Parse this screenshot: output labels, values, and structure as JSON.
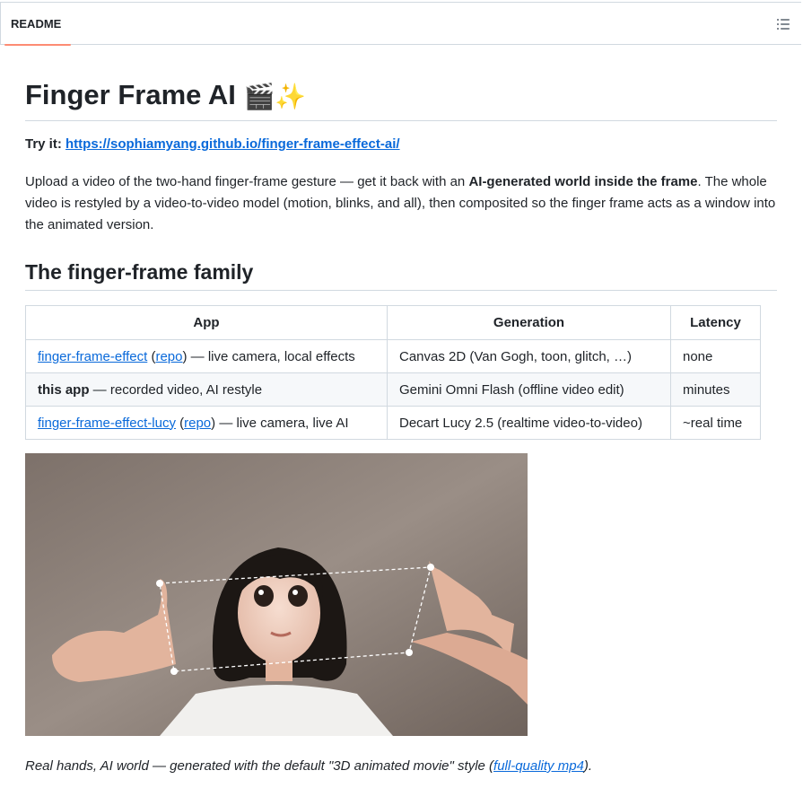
{
  "tabs": {
    "readme_label": "README",
    "toc_icon": "list-unordered-icon"
  },
  "readme": {
    "title": "Finger Frame AI",
    "title_emoji_1": "🎬",
    "title_emoji_2": "✨",
    "try_label": "Try it:",
    "try_url": "https://sophiamyang.github.io/finger-frame-effect-ai/",
    "intro_part1": "Upload a video of the two-hand finger-frame gesture — get it back with an ",
    "intro_bold": "AI-generated world inside the frame",
    "intro_part2": ". The whole video is restyled by a video-to-video model (motion, blinks, and all), then composited so the finger frame acts as a window into the animated version.",
    "family_heading": "The finger-frame family",
    "table": {
      "headers": [
        "App",
        "Generation",
        "Latency"
      ],
      "rows": [
        {
          "link": "finger-frame-effect",
          "open": " (",
          "repo": "repo",
          "rest": ") — live camera, local effects",
          "generation": "Canvas 2D (Van Gogh, toon, glitch, …)",
          "latency": "none"
        },
        {
          "bold": "this app",
          "rest": " — recorded video, AI restyle",
          "generation": "Gemini Omni Flash (offline video edit)",
          "latency": "minutes"
        },
        {
          "link": "finger-frame-effect-lucy",
          "open": " (",
          "repo": "repo",
          "rest": ") — live camera, live AI",
          "generation": "Decart Lucy 2.5 (realtime video-to-video)",
          "latency": "~real time"
        }
      ]
    },
    "caption_text": "Real hands, AI world — generated with the default \"3D animated movie\" style (",
    "caption_link": "full-quality mp4",
    "caption_end": ")."
  }
}
